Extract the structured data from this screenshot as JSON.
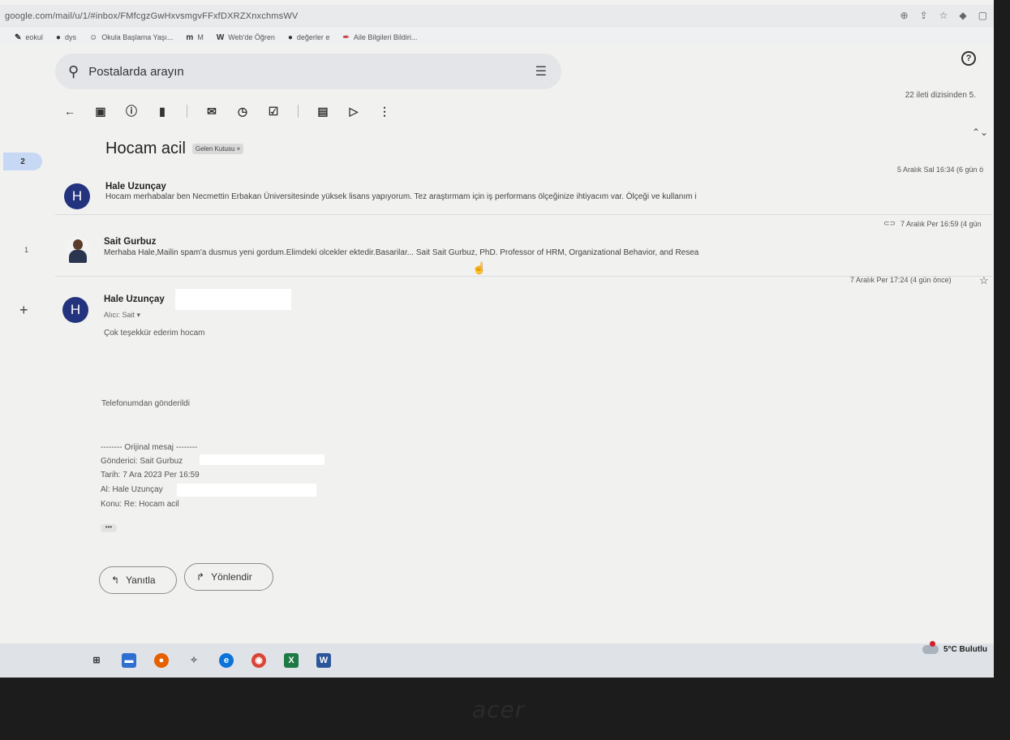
{
  "browser": {
    "url": "google.com/mail/u/1/#inbox/FMfcgzGwHxvsmgvFFxfDXRZXnxchmsWV",
    "bookmarks": [
      {
        "icon": "graduation-icon",
        "label": "eokul"
      },
      {
        "icon": "globe-icon",
        "label": "dys"
      },
      {
        "icon": "smile-icon",
        "label": "Okula Başlama Yaşı..."
      },
      {
        "icon": "m-logo-icon",
        "label": "M"
      },
      {
        "icon": "w-logo-icon",
        "label": "Web'de Öğren"
      },
      {
        "icon": "globe-icon",
        "label": "değerler e"
      },
      {
        "icon": "feather-icon",
        "label": "Aile Bilgileri Bildiri..."
      }
    ]
  },
  "search": {
    "placeholder": "Postalarda arayın"
  },
  "nav": {
    "badge": "2",
    "count": "1"
  },
  "thread": {
    "position": "22 ileti dizisinden 5.",
    "subject": "Hocam acil",
    "label": "Gelen Kutusu ×"
  },
  "messages": [
    {
      "sender": "Hale Uzunçay",
      "avatar": "H",
      "snippet": "Hocam merhabalar ben Necmettin Erbakan Üniversitesinde yüksek lisans yapıyorum. Tez araştırmam için iş performans ölçeğinize ihtiyacım var. Ölçeği ve kullanım i",
      "date": "5 Aralık Sal 16:34 (6 gün ö"
    },
    {
      "sender": "Sait Gurbuz",
      "snippet": "Merhaba Hale,Mailin spam'a dusmus yeni gordum.Elimdeki olcekler ektedir.Basarilar... Sait Sait Gurbuz, PhD. Professor of HRM, Organizational Behavior, and Resea",
      "date": "7 Aralık Per 16:59 (4 gün"
    },
    {
      "sender": "Hale Uzunçay",
      "avatar": "H",
      "to": "Alıcı: Sait ▾",
      "date": "7 Aralık Per 17:24 (4 gün önce)",
      "body": [
        "Çok teşekkür ederim hocam",
        "Telefonumdan gönderildi",
        "-------- Orijinal mesaj --------",
        "Gönderici: Sait Gurbuz",
        "Tarih: 7 Ara 2023 Per 16:59",
        "Al: Hale Uzunçay",
        "Konu: Re: Hocam acil"
      ]
    }
  ],
  "actions": {
    "reply": "Yanıtla",
    "forward": "Yönlendir",
    "more": "•••"
  },
  "taskbar": {
    "weather": "5°C  Bulutlu",
    "apps": [
      "task-view-icon",
      "file-explorer-icon",
      "firefox-icon",
      "app-icon",
      "edge-icon",
      "chrome-icon",
      "excel-icon",
      "word-icon"
    ]
  },
  "monitor": {
    "brand": "acer"
  }
}
